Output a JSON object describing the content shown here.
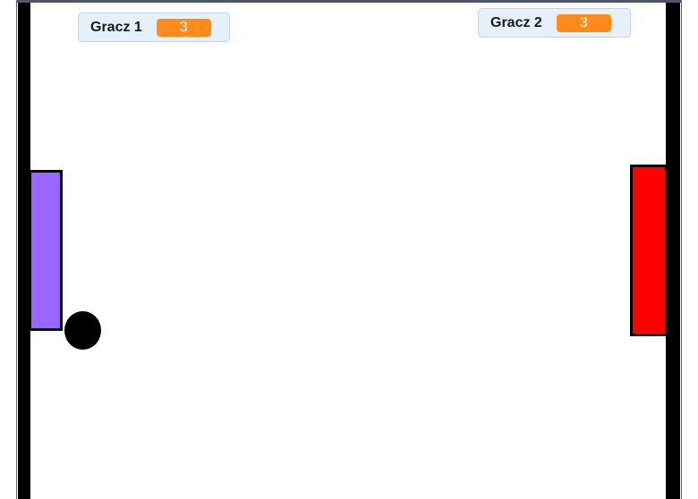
{
  "game": {
    "colors": {
      "background": "#ffffff",
      "wall": "#000000",
      "paddle_player1": "#9966ff",
      "paddle_player2": "#ff0000",
      "ball": "#000000",
      "monitor_value_bg": "#ff8c1a"
    },
    "monitors": [
      {
        "label": "Gracz 1",
        "value": "3"
      },
      {
        "label": "Gracz 2",
        "value": "3"
      }
    ]
  }
}
